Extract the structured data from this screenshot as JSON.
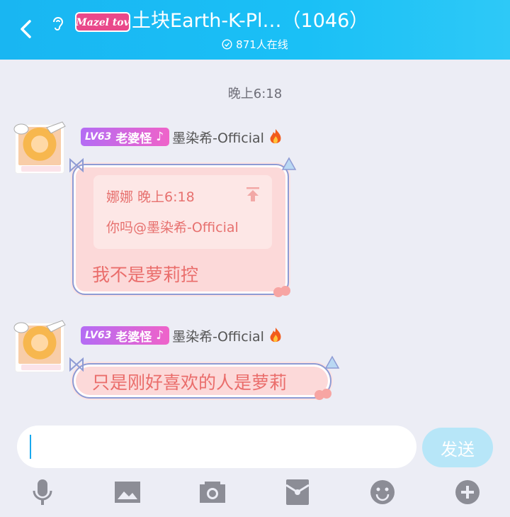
{
  "header": {
    "title": "土块Earth-K-Pl…（1046）",
    "online": "871人在线",
    "badge_text": "Mazel tov"
  },
  "chat": {
    "time": "晚上6:18",
    "messages": [
      {
        "level": "LV63",
        "title": "老婆怪",
        "note": "♪",
        "sender": "墨染希-Official",
        "quote_name": "娜娜 晚上6:18",
        "quote_text": "你吗@墨染希-Official",
        "text": "我不是萝莉控"
      },
      {
        "level": "LV63",
        "title": "老婆怪",
        "note": "♪",
        "sender": "墨染希-Official",
        "text": "只是刚好喜欢的人是萝莉"
      }
    ]
  },
  "input": {
    "value": "",
    "send_label": "发送"
  },
  "toolbar": [
    "microphone-icon",
    "image-icon",
    "camera-icon",
    "red-packet-icon",
    "emoji-icon",
    "plus-icon"
  ],
  "colors": {
    "header": "#19b6f2",
    "bubble": "#fcd9d9",
    "bubble_text": "#ea6d6b",
    "send": "#b7e6f8"
  }
}
